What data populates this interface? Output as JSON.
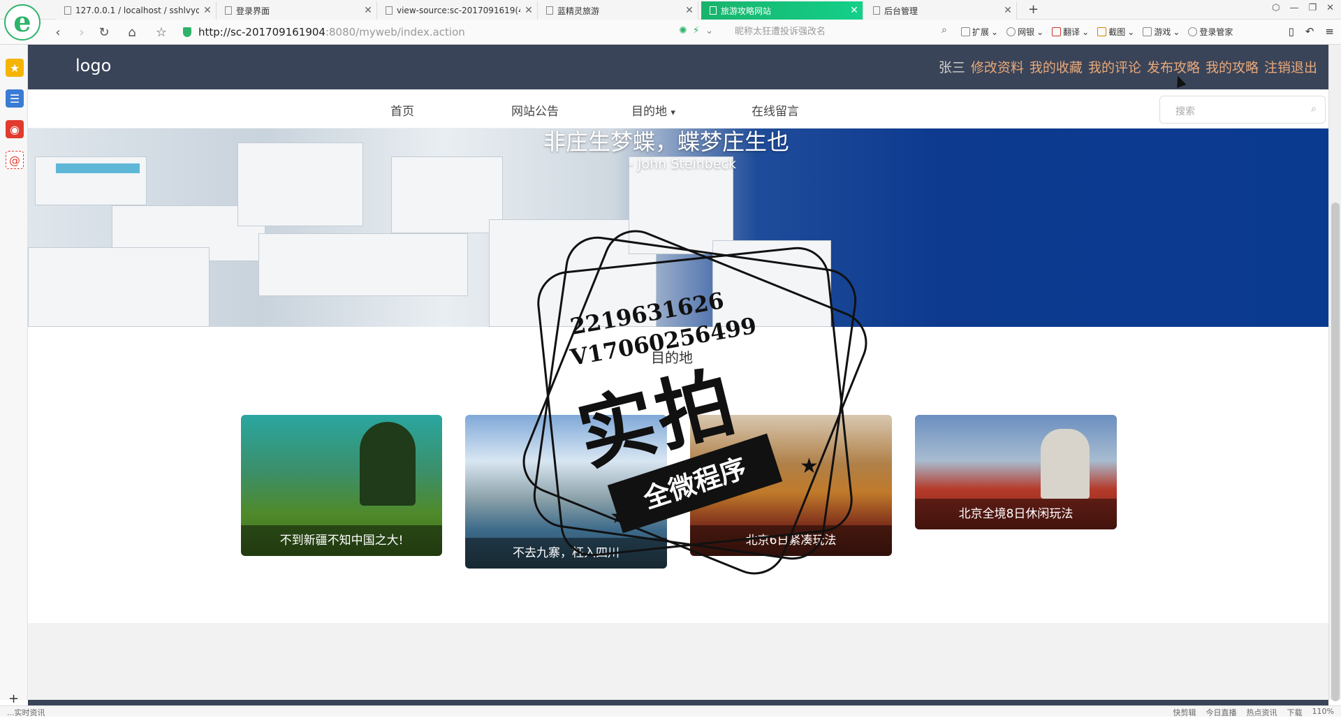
{
  "browser": {
    "tabs": [
      {
        "title": "127.0.0.1 / localhost / sshlvyo"
      },
      {
        "title": "登录界面"
      },
      {
        "title": "view-source:sc-2017091619(4"
      },
      {
        "title": "蓝精灵旅游"
      },
      {
        "title": "旅游攻略网站"
      },
      {
        "title": "后台管理"
      }
    ],
    "address": {
      "host": "http://sc-201709161904",
      "rest": ":8080/myweb/index.action"
    },
    "search_placeholder": "昵称太狂遭投诉强改名",
    "toolbar": [
      "扩展",
      "网银",
      "翻译",
      "截图",
      "游戏",
      "登录管家"
    ],
    "status_left": "...实时资讯",
    "status_right": [
      "快剪辑",
      "今日直播",
      "热点资讯",
      "下载",
      "110%"
    ]
  },
  "site": {
    "logo": "logo",
    "username": "张三",
    "user_links": [
      "修改资料",
      "我的收藏",
      "我的评论",
      "发布攻略",
      "我的攻略",
      "注销退出"
    ],
    "nav": [
      "首页",
      "网站公告",
      "目的地",
      "在线留言"
    ],
    "search_placeholder": "搜索",
    "banner_quote": "非庄生梦蝶，蝶梦庄生也",
    "banner_author": "- John Steinbeck",
    "section_title": "目的地",
    "cards": [
      {
        "caption": "不到新疆不知中国之大!"
      },
      {
        "caption": "不去九寨，枉入四川"
      },
      {
        "caption": "北京6日紧凑玩法"
      },
      {
        "caption": "北京全境8日休闲玩法"
      }
    ]
  },
  "stamp": {
    "line1": "2219631626",
    "line2": "V17060256499",
    "big": "实拍",
    "ribbon": "全微程序"
  },
  "colors": {
    "header": "#3a4458",
    "user_link": "#e8a97a",
    "active_tab": "#19b36b"
  }
}
